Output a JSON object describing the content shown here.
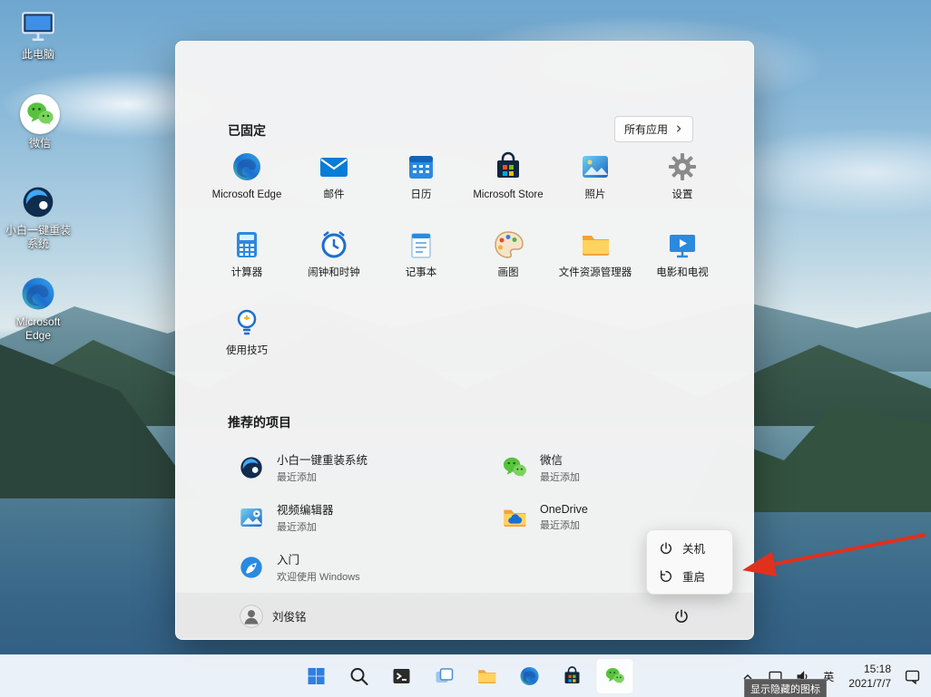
{
  "desktop": {
    "icons": [
      {
        "label": "此电脑"
      },
      {
        "label": "微信"
      },
      {
        "label": "小白一键重装系统"
      },
      {
        "label": "Microsoft Edge"
      }
    ]
  },
  "start_menu": {
    "pinned_header": "已固定",
    "all_apps_label": "所有应用",
    "pinned_apps": [
      {
        "label": "Microsoft Edge"
      },
      {
        "label": "邮件"
      },
      {
        "label": "日历"
      },
      {
        "label": "Microsoft Store"
      },
      {
        "label": "照片"
      },
      {
        "label": "设置"
      },
      {
        "label": "计算器"
      },
      {
        "label": "闹钟和时钟"
      },
      {
        "label": "记事本"
      },
      {
        "label": "画图"
      },
      {
        "label": "文件资源管理器"
      },
      {
        "label": "电影和电视"
      },
      {
        "label": "使用技巧"
      }
    ],
    "recommended_header": "推荐的项目",
    "recommended": [
      {
        "label": "小白一键重装系统",
        "sublabel": "最近添加"
      },
      {
        "label": "微信",
        "sublabel": "最近添加"
      },
      {
        "label": "视频编辑器",
        "sublabel": "最近添加"
      },
      {
        "label": "OneDrive",
        "sublabel": "最近添加"
      },
      {
        "label": "入门",
        "sublabel": "欢迎使用 Windows"
      }
    ],
    "user_name": "刘俊铭",
    "power_menu": {
      "shutdown": "关机",
      "restart": "重启"
    }
  },
  "taskbar": {
    "tray": {
      "time": "15:18",
      "date": "2021/7/7",
      "language": "英",
      "hidden_icons_tooltip": "显示隐藏的图标"
    }
  },
  "colors": {
    "accent": "#2a8ae0",
    "wechat_green": "#57c23d",
    "arrow_red": "#e0301e"
  }
}
